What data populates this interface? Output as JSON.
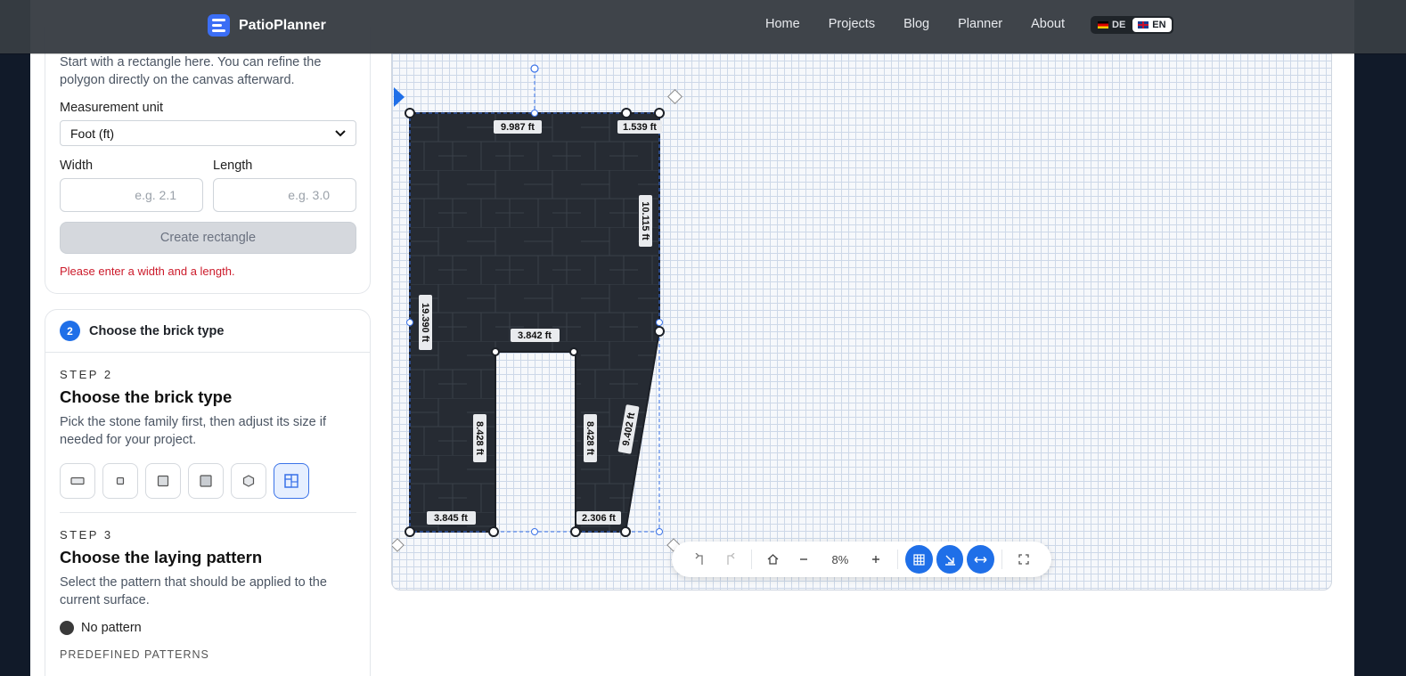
{
  "nav": {
    "brand": "PatioPlanner",
    "links": [
      "Home",
      "Projects",
      "Blog",
      "Planner",
      "About"
    ],
    "lang_de": "DE",
    "lang_en": "EN"
  },
  "step1": {
    "intro": "Start with a rectangle here. You can refine the polygon directly on the canvas afterward.",
    "unit_label": "Measurement unit",
    "unit_value": "Foot (ft)",
    "width_label": "Width",
    "length_label": "Length",
    "width_placeholder": "e.g. 2.1",
    "length_placeholder": "e.g. 3.0",
    "create_button": "Create rectangle",
    "error": "Please enter a width and a length."
  },
  "step2": {
    "number": "2",
    "header_title": "Choose the brick type",
    "eyebrow": "STEP 2",
    "title": "Choose the brick type",
    "desc": "Pick the stone family first, then adjust its size if needed for your project.",
    "brick_types": [
      "rectangle-brick-icon",
      "small-square-brick-icon",
      "square-brick-icon",
      "large-square-brick-icon",
      "hexagon-brick-icon",
      "mixed-format-brick-icon"
    ],
    "selected_index": 5
  },
  "step3": {
    "eyebrow": "STEP 3",
    "title": "Choose the laying pattern",
    "desc": "Select the pattern that should be applied to the current surface.",
    "no_pattern": "No pattern",
    "predefined": "PREDEFINED PATTERNS"
  },
  "canvas": {
    "edge_labels": {
      "top": "9.987 ft",
      "top_right": "1.539 ft",
      "right": "10.115 ft",
      "left": "19.390 ft",
      "inner_top": "3.842 ft",
      "inner_left": "8.428 ft",
      "inner_right": "8.428 ft",
      "diag": "9.402 ft",
      "bottom_left": "3.845 ft",
      "bottom_right": "2.306 ft"
    },
    "zoom": "8%"
  },
  "colors": {
    "accent": "#1f6fe8",
    "surface": "#262b33",
    "error": "#cc1b2b"
  }
}
